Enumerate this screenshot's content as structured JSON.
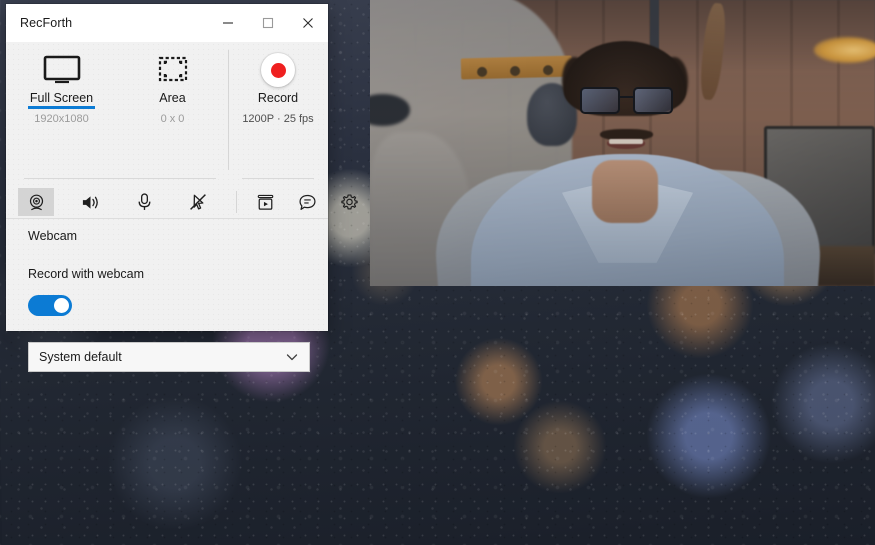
{
  "window": {
    "title": "RecForth",
    "controls": {
      "minimize": "minimize",
      "maximize": "maximize",
      "close": "close"
    }
  },
  "capture_modes": [
    {
      "id": "full-screen",
      "label": "Full Screen",
      "sublabel": "1920x1080",
      "icon": "monitor-icon",
      "active": true
    },
    {
      "id": "area",
      "label": "Area",
      "sublabel": "0 x 0",
      "icon": "selection-area-icon",
      "active": false
    }
  ],
  "record": {
    "label": "Record",
    "sublabel": "1200P · 25 fps",
    "icon": "record-dot-icon"
  },
  "toolbar": {
    "left_items": [
      {
        "id": "webcam",
        "icon": "webcam-icon",
        "selected": true,
        "tooltip": "Webcam"
      },
      {
        "id": "system-audio",
        "icon": "speaker-icon",
        "selected": false,
        "tooltip": "System audio"
      },
      {
        "id": "microphone",
        "icon": "microphone-icon",
        "selected": false,
        "tooltip": "Microphone"
      },
      {
        "id": "mouse-click",
        "icon": "cursor-disabled-icon",
        "selected": false,
        "tooltip": "Mouse click effects"
      }
    ],
    "right_items": [
      {
        "id": "recordings",
        "icon": "video-library-icon",
        "tooltip": "Recordings"
      },
      {
        "id": "feedback",
        "icon": "feedback-icon",
        "tooltip": "Feedback"
      },
      {
        "id": "settings",
        "icon": "gear-icon",
        "tooltip": "Settings"
      }
    ]
  },
  "panel": {
    "section_title": "Webcam",
    "option_label": "Record with webcam",
    "toggle_state": "on",
    "device_select": {
      "value": "System default",
      "chevron": "chevron-down-icon"
    }
  },
  "colors": {
    "accent": "#0C7BD4",
    "record_red": "#EF2020",
    "window_bg": "#F1F1F1",
    "titlebar_bg": "#FFFFFF",
    "muted_text": "#9B9B9B"
  },
  "desktop": {
    "wallpaper": "rain-on-glass-bokeh-wallpaper",
    "webcam_preview": "webcam-preview-overlay"
  }
}
